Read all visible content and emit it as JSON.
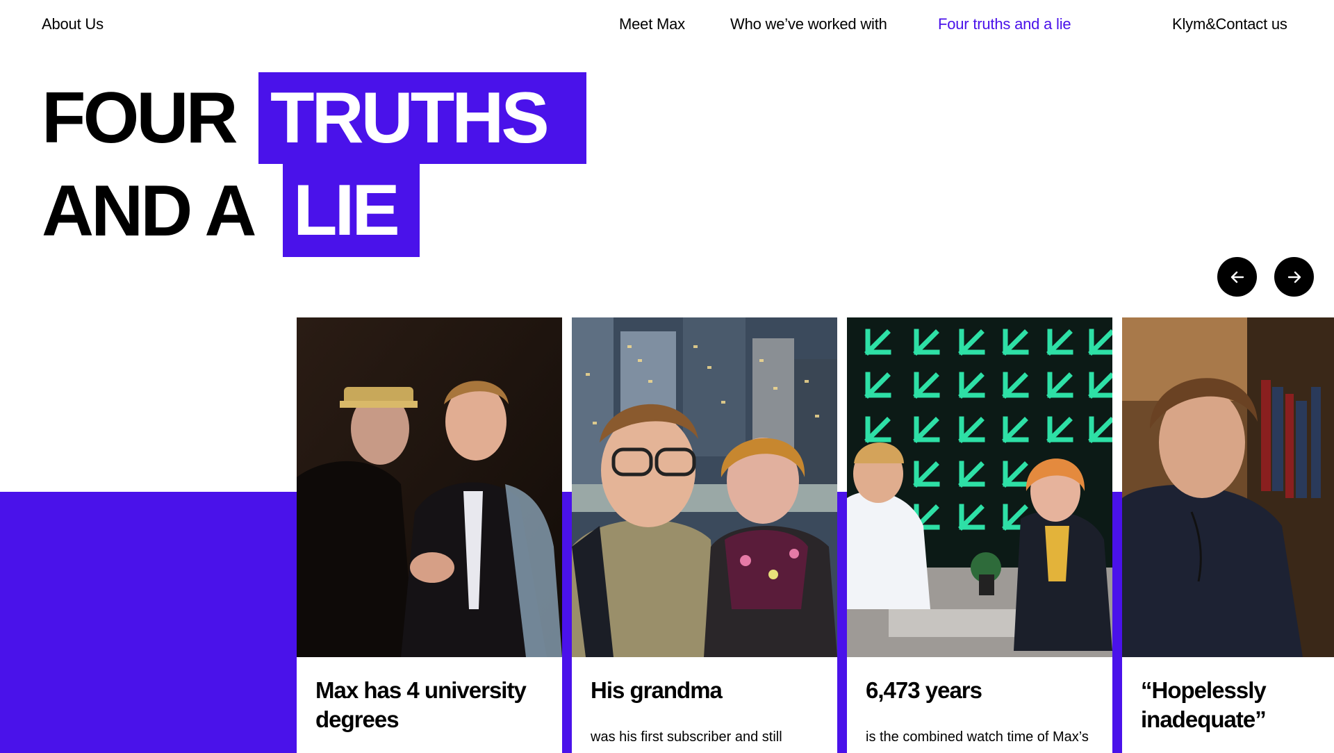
{
  "nav": {
    "about": "About Us",
    "meet": "Meet Max",
    "worked": "Who we’ve worked with",
    "truths": "Four truths and a lie",
    "contact": "Klym&Contact us"
  },
  "hero": {
    "word1": "FOUR",
    "word2": "TRUTHS",
    "word3": "AND A",
    "word4": "LIE"
  },
  "carousel": {
    "prev_icon": "arrow-left-icon",
    "next_icon": "arrow-right-icon",
    "cards": [
      {
        "title": "Max has 4 university degrees",
        "subtitle": ""
      },
      {
        "title": "His grandma",
        "subtitle": "was his first subscriber and still"
      },
      {
        "title": "6,473 years",
        "subtitle": "is the combined watch time of Max’s"
      },
      {
        "title": "“Hopelessly inadequate”",
        "subtitle": ""
      }
    ]
  },
  "colors": {
    "accent": "#4a12ea",
    "text": "#000000",
    "background": "#ffffff"
  }
}
